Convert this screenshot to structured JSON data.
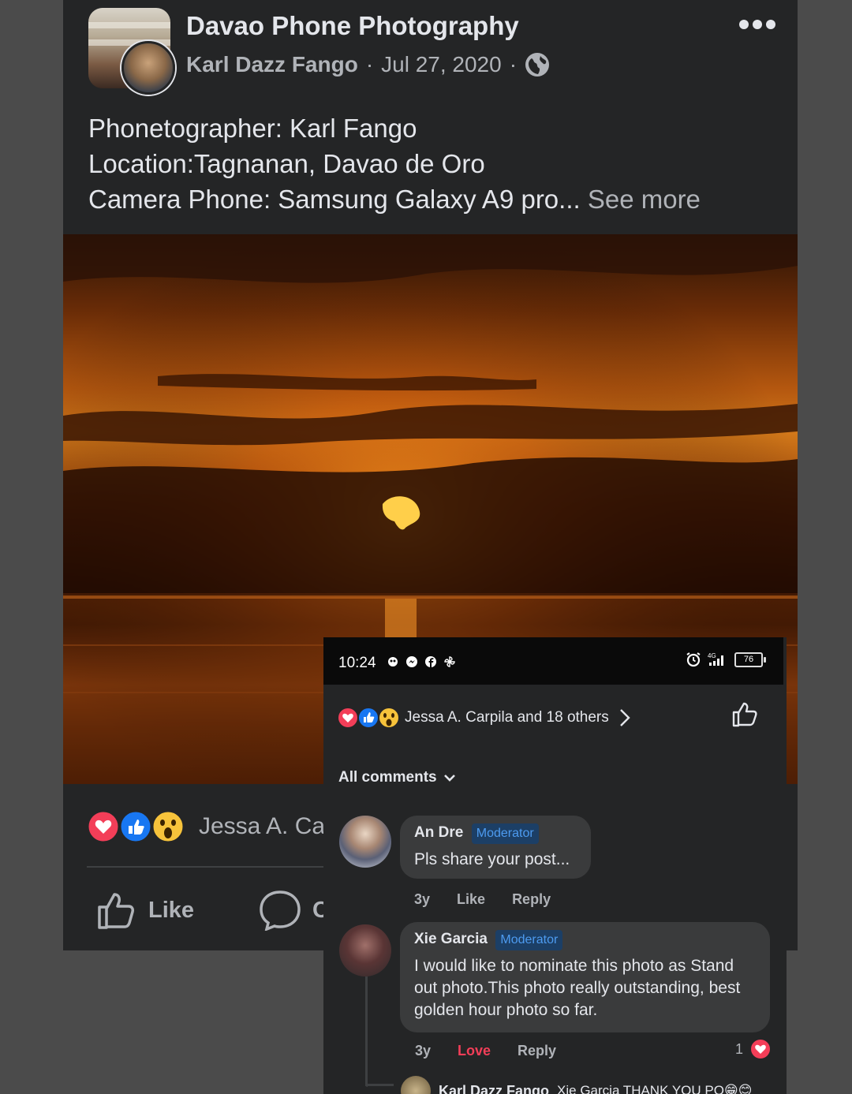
{
  "post": {
    "group_name": "Davao Phone Photography",
    "author": "Karl Dazz Fango",
    "separator": "·",
    "date": "Jul 27, 2020",
    "caption_lines": [
      "Phonetographer: Karl Fango",
      "Location:Tagnanan, Davao de Oro",
      "Camera Phone: Samsung Galaxy A9 pro..."
    ],
    "see_more": "See more",
    "reactions_text": "Jessa A. Carp",
    "like_label": "Like",
    "comment_label": "C"
  },
  "icons": {
    "more": "more-horizontal-icon",
    "privacy": "globe-icon",
    "like": "thumbs-up-icon",
    "comment": "comment-bubble-icon",
    "reactions": [
      "love-reaction-icon",
      "like-reaction-icon",
      "wow-reaction-icon"
    ]
  },
  "colors": {
    "card_bg": "#242526",
    "page_bg": "#4b4b4b",
    "text_primary": "#e4e6eb",
    "text_secondary": "#b0b3b8",
    "love": "#f33e58",
    "like_blue": "#1877f2",
    "moderator_text": "#4d9bf0"
  },
  "phone": {
    "status": {
      "time": "10:24",
      "network": "4G",
      "battery": "76"
    },
    "reactions_text": "Jessa A. Carpila and 18 others",
    "all_comments_label": "All comments",
    "comments": [
      {
        "name": "An Dre",
        "badge": "Moderator",
        "text": "Pls share your post...",
        "time": "3y",
        "like_label": "Like",
        "reply_label": "Reply"
      },
      {
        "name": "Xie Garcia",
        "badge": "Moderator",
        "text": "I would like to nominate this photo as Stand out photo.This photo really outstanding, best golden hour photo so far.",
        "time": "3y",
        "like_label": "Love",
        "reply_label": "Reply",
        "reaction_count": "1"
      }
    ],
    "reply": {
      "name": "Karl Dazz Fango",
      "text": "Xie Garcia THANK YOU PO😁😊"
    }
  }
}
